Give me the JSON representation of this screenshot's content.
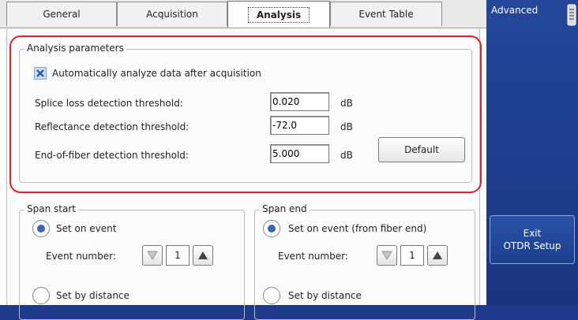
{
  "tabs": [
    {
      "label": "General"
    },
    {
      "label": "Acquisition"
    },
    {
      "label": "Analysis"
    },
    {
      "label": "Event Table"
    }
  ],
  "analysis_params": {
    "title": "Analysis parameters",
    "auto_analyze_label": "Automatically analyze data after acquisition",
    "auto_analyze_checked": true,
    "splice_label": "Splice loss detection threshold:",
    "splice_value": "0.020",
    "splice_unit": "dB",
    "reflectance_label": "Reflectance detection threshold:",
    "reflectance_value": "-72.0",
    "reflectance_unit": "dB",
    "eof_label": "End-of-fiber detection threshold:",
    "eof_value": "5.000",
    "eof_unit": "dB",
    "default_button": "Default"
  },
  "span_start": {
    "title": "Span start",
    "set_on_event_label": "Set on event",
    "event_number_label": "Event number:",
    "event_number_value": "1",
    "set_by_distance_label": "Set by distance"
  },
  "span_end": {
    "title": "Span end",
    "set_on_event_label": "Set on event (from fiber end)",
    "event_number_label": "Event number:",
    "event_number_value": "1",
    "set_by_distance_label": "Set by distance"
  },
  "sidebar": {
    "advanced_label": "Advanced",
    "exit_line1": "Exit",
    "exit_line2": "OTDR Setup"
  }
}
